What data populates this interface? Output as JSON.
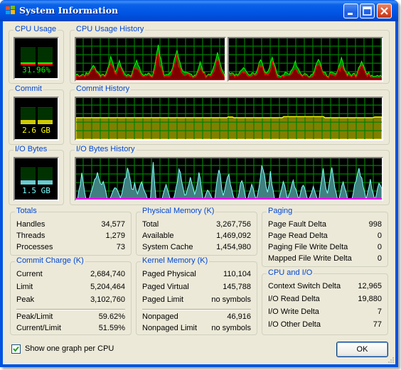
{
  "window": {
    "title": "System Information"
  },
  "cpu_usage": {
    "label": "CPU Usage",
    "value": "31.96%",
    "color": "#00ff00",
    "fill_fraction": 0.32
  },
  "cpu_history": {
    "label": "CPU Usage History",
    "graphs_count": 2,
    "total_color": "#00ff00",
    "kernel_color": "#ff0000"
  },
  "commit": {
    "label": "Commit",
    "value": "2.6 GB",
    "color": "#ffff00",
    "fill_fraction": 0.52
  },
  "commit_history": {
    "label": "Commit History",
    "line_color": "#ffff00",
    "fill_color": "#808000",
    "level_fraction": 0.52
  },
  "io_bytes": {
    "label": "I/O Bytes",
    "value": "1.5 GB",
    "color": "#80ffff"
  },
  "io_history": {
    "label": "I/O Bytes History",
    "line_color": "#80ffff",
    "fill_color": "#408080",
    "baseline_color": "#ff00ff"
  },
  "totals": {
    "label": "Totals",
    "rows": [
      {
        "label": "Handles",
        "value": "34,577"
      },
      {
        "label": "Threads",
        "value": "1,279"
      },
      {
        "label": "Processes",
        "value": "73"
      }
    ]
  },
  "commit_charge": {
    "label": "Commit Charge (K)",
    "rows": [
      {
        "label": "Current",
        "value": "2,684,740"
      },
      {
        "label": "Limit",
        "value": "5,204,464"
      },
      {
        "label": "Peak",
        "value": "3,102,760"
      }
    ],
    "rows2": [
      {
        "label": "Peak/Limit",
        "value": "59.62%"
      },
      {
        "label": "Current/Limit",
        "value": "51.59%"
      }
    ]
  },
  "physical_memory": {
    "label": "Physical Memory (K)",
    "rows": [
      {
        "label": "Total",
        "value": "3,267,756"
      },
      {
        "label": "Available",
        "value": "1,469,092"
      },
      {
        "label": "System Cache",
        "value": "1,454,980"
      }
    ]
  },
  "kernel_memory": {
    "label": "Kernel Memory (K)",
    "rows": [
      {
        "label": "Paged Physical",
        "value": "110,104"
      },
      {
        "label": "Paged Virtual",
        "value": "145,788"
      },
      {
        "label": "Paged Limit",
        "value": "no symbols"
      }
    ],
    "rows2": [
      {
        "label": "Nonpaged",
        "value": "46,916"
      },
      {
        "label": "Nonpaged Limit",
        "value": "no symbols"
      }
    ]
  },
  "paging": {
    "label": "Paging",
    "rows": [
      {
        "label": "Page Fault Delta",
        "value": "998"
      },
      {
        "label": "Page Read Delta",
        "value": "0"
      },
      {
        "label": "Paging File Write Delta",
        "value": "0"
      },
      {
        "label": "Mapped File Write Delta",
        "value": "0"
      }
    ]
  },
  "cpu_io": {
    "label": "CPU and I/O",
    "rows": [
      {
        "label": "Context Switch Delta",
        "value": "12,965"
      },
      {
        "label": "I/O Read Delta",
        "value": "19,880"
      },
      {
        "label": "I/O Write Delta",
        "value": "7"
      },
      {
        "label": "I/O Other Delta",
        "value": "77"
      }
    ]
  },
  "footer": {
    "checkbox_label": "Show one graph per CPU",
    "checkbox_checked": true,
    "ok_label": "OK"
  }
}
